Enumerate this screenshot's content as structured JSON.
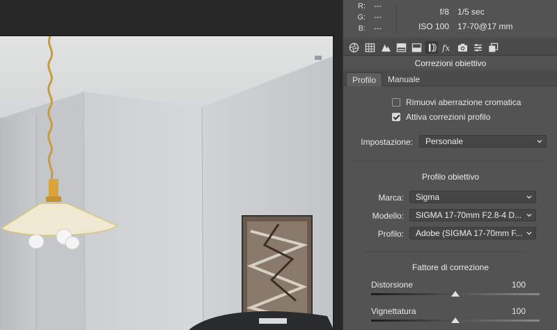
{
  "info": {
    "rgb": [
      {
        "label": "R:",
        "value": "---"
      },
      {
        "label": "G:",
        "value": "---"
      },
      {
        "label": "B:",
        "value": "---"
      }
    ],
    "aperture": "f/8",
    "shutter": "1/5 sec",
    "iso": "ISO 100",
    "lens": "17-70@17 mm"
  },
  "toolbar": {
    "icons": [
      "aperture-icon",
      "grid-icon",
      "mountain-icon",
      "split-tone-icon",
      "detail-icon",
      "lens-icon",
      "fx-icon",
      "camera-icon",
      "sliders-icon",
      "presets-icon"
    ],
    "active_index": 5
  },
  "panel": {
    "title": "Correzioni obiettivo",
    "tabs": [
      {
        "label": "Profilo",
        "active": true
      },
      {
        "label": "Manuale",
        "active": false
      }
    ],
    "chromatic_aberration": {
      "label": "Rimuovi aberrazione cromatica",
      "checked": false
    },
    "profile_corrections": {
      "label": "Attiva correzioni profilo",
      "checked": true
    },
    "setting": {
      "label": "Impostazione:",
      "value": "Personale"
    },
    "lens_profile": {
      "title": "Profilo obiettivo",
      "make": {
        "label": "Marca:",
        "value": "Sigma"
      },
      "model": {
        "label": "Modello:",
        "value": "SIGMA 17-70mm F2.8-4 D..."
      },
      "profile": {
        "label": "Profilo:",
        "value": "Adobe (SIGMA 17-70mm F..."
      }
    },
    "correction": {
      "title": "Fattore di correzione",
      "distortion": {
        "label": "Distorsione",
        "value": "100",
        "fraction": 0.5
      },
      "vignetting": {
        "label": "Vignettatura",
        "value": "100",
        "fraction": 0.5
      }
    }
  }
}
